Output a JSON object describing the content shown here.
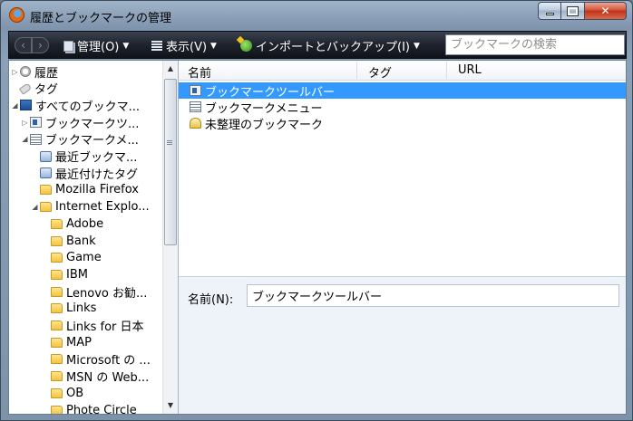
{
  "window": {
    "title": "履歴とブックマークの管理"
  },
  "toolbar": {
    "organize": "管理(O)",
    "views": "表示(V)",
    "import_backup": "インポートとバックアップ(I)",
    "search_placeholder": "ブックマークの検索"
  },
  "tree": {
    "items": [
      {
        "label": "履歴",
        "twist": "▷",
        "icon": "history-icon",
        "depth": 0
      },
      {
        "label": "タグ",
        "twist": "",
        "icon": "tag-icon",
        "depth": 0
      },
      {
        "label": "すべてのブックマ...",
        "twist": "◢",
        "icon": "library-icon",
        "depth": 0
      },
      {
        "label": "ブックマークツ...",
        "twist": "▷",
        "icon": "bookmarks-toolbar-icon",
        "depth": 1
      },
      {
        "label": "ブックマークメ...",
        "twist": "◢",
        "icon": "bookmarks-menu-icon",
        "depth": 1
      },
      {
        "label": "最近ブックマ...",
        "twist": "",
        "icon": "smart-query-icon",
        "depth": 2
      },
      {
        "label": "最近付けたタグ",
        "twist": "",
        "icon": "smart-query-icon",
        "depth": 2
      },
      {
        "label": "Mozilla Firefox",
        "twist": "",
        "icon": "folder-icon",
        "depth": 2
      },
      {
        "label": "Internet Explo...",
        "twist": "◢",
        "icon": "folder-icon",
        "depth": 2
      },
      {
        "label": "Adobe",
        "twist": "",
        "icon": "folder-icon",
        "depth": 3
      },
      {
        "label": "Bank",
        "twist": "",
        "icon": "folder-icon",
        "depth": 3
      },
      {
        "label": "Game",
        "twist": "",
        "icon": "folder-icon",
        "depth": 3
      },
      {
        "label": "IBM",
        "twist": "",
        "icon": "folder-icon",
        "depth": 3
      },
      {
        "label": "Lenovo お勧...",
        "twist": "",
        "icon": "folder-icon",
        "depth": 3
      },
      {
        "label": "Links",
        "twist": "",
        "icon": "folder-icon",
        "depth": 3
      },
      {
        "label": "Links for 日本",
        "twist": "",
        "icon": "folder-icon",
        "depth": 3
      },
      {
        "label": "MAP",
        "twist": "",
        "icon": "folder-icon",
        "depth": 3
      },
      {
        "label": "Microsoft の ...",
        "twist": "",
        "icon": "folder-icon",
        "depth": 3
      },
      {
        "label": "MSN の Web...",
        "twist": "",
        "icon": "folder-icon",
        "depth": 3
      },
      {
        "label": "OB",
        "twist": "",
        "icon": "folder-icon",
        "depth": 3
      },
      {
        "label": "Phote Circle",
        "twist": "",
        "icon": "folder-icon",
        "depth": 3
      }
    ]
  },
  "list": {
    "columns": [
      "名前",
      "タグ",
      "URL"
    ],
    "rows": [
      {
        "name": "ブックマークツールバー",
        "icon": "bookmarks-toolbar-icon",
        "selected": true
      },
      {
        "name": "ブックマークメニュー",
        "icon": "bookmarks-menu-icon",
        "selected": false
      },
      {
        "name": "未整理のブックマーク",
        "icon": "unsorted-bookmarks-icon",
        "selected": false
      }
    ]
  },
  "details": {
    "name_label": "名前(N):",
    "name_value": "ブックマークツールバー"
  }
}
